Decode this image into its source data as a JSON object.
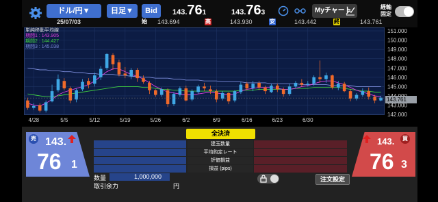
{
  "toolbar": {
    "currency_pair": "ドル/円▼",
    "timeframe": "日足▼",
    "bid_label": "Bid",
    "bid_price": {
      "small": "143.",
      "big": "76",
      "tail": "1"
    },
    "ask_price": {
      "small": "143.",
      "big": "76",
      "tail": "3"
    },
    "my_chart_label": "Myチャート",
    "toggle_label_line1": "経軸",
    "toggle_label_line2": "固定"
  },
  "info": {
    "date": "25/07/03",
    "open_label": "始",
    "open": "143.694",
    "high_label": "高",
    "high": "143.930",
    "low_label": "安",
    "low": "143.442",
    "close_label": "終",
    "close": "143.761"
  },
  "chart_legend": {
    "title": "単純移動平均線",
    "period1": "期間1 : 143.905",
    "period2": "期間2 : 144.427",
    "period3": "期間3 : 145.038"
  },
  "chart_data": {
    "type": "candlestick",
    "x_ticks": [
      "4/28",
      "5/5",
      "5/12",
      "5/19",
      "5/26",
      "6/2",
      "6/9",
      "6/16",
      "6/23",
      "6/30"
    ],
    "y_ticks": [
      "151.000",
      "150.000",
      "149.000",
      "148.000",
      "147.000",
      "146.000",
      "145.000",
      "144.000",
      "143.000",
      "142.000"
    ],
    "ylim": [
      142,
      151.3
    ],
    "current_price": "143.761",
    "candles": [
      [
        143.5,
        142.7,
        143.8,
        142.5
      ],
      [
        142.7,
        142.9,
        143.2,
        142.5
      ],
      [
        143.0,
        142.4,
        143.2,
        142.2
      ],
      [
        142.4,
        143.3,
        143.5,
        142.2
      ],
      [
        143.4,
        144.5,
        145.2,
        143.3
      ],
      [
        144.6,
        145.8,
        146.3,
        144.4
      ],
      [
        145.6,
        144.8,
        145.9,
        144.6
      ],
      [
        144.8,
        143.5,
        145.0,
        143.2
      ],
      [
        143.6,
        144.6,
        144.8,
        143.3
      ],
      [
        144.7,
        145.5,
        145.8,
        144.5
      ],
      [
        145.6,
        145.2,
        145.9,
        144.8
      ],
      [
        145.3,
        146.2,
        146.5,
        145.0
      ],
      [
        146.0,
        146.9,
        147.2,
        145.7
      ],
      [
        147.0,
        148.5,
        148.6,
        146.8
      ],
      [
        148.4,
        147.4,
        148.6,
        146.8
      ],
      [
        147.6,
        146.3,
        147.9,
        146.1
      ],
      [
        146.4,
        146.2,
        147.1,
        145.9
      ],
      [
        146.1,
        146.8,
        147.0,
        145.8
      ],
      [
        146.8,
        145.9,
        147.0,
        145.5
      ],
      [
        145.9,
        145.5,
        146.2,
        145.3
      ],
      [
        145.4,
        144.6,
        145.6,
        144.2
      ],
      [
        144.6,
        144.1,
        144.7,
        143.9
      ],
      [
        144.1,
        144.7,
        144.9,
        143.9
      ],
      [
        144.6,
        143.1,
        144.8,
        142.8
      ],
      [
        143.1,
        144.2,
        144.4,
        142.9
      ],
      [
        144.1,
        144.8,
        145.0,
        143.9
      ],
      [
        144.8,
        143.5,
        145.1,
        143.4
      ],
      [
        143.6,
        144.5,
        144.7,
        143.4
      ],
      [
        144.4,
        145.0,
        145.2,
        144.2
      ],
      [
        145.0,
        144.8,
        145.4,
        144.5
      ],
      [
        144.7,
        144.5,
        145.1,
        144.2
      ],
      [
        144.5,
        143.6,
        144.7,
        143.3
      ],
      [
        143.7,
        144.3,
        144.5,
        143.5
      ],
      [
        144.3,
        143.4,
        144.4,
        143.1
      ],
      [
        143.5,
        144.5,
        144.6,
        143.3
      ],
      [
        144.4,
        145.2,
        145.5,
        144.2
      ],
      [
        145.3,
        144.8,
        145.5,
        144.6
      ],
      [
        144.8,
        145.3,
        145.6,
        144.5
      ],
      [
        145.4,
        144.9,
        145.6,
        144.6
      ],
      [
        144.9,
        144.5,
        145.1,
        144.2
      ],
      [
        144.4,
        145.1,
        145.3,
        144.3
      ],
      [
        145.1,
        144.7,
        145.3,
        144.4
      ],
      [
        144.7,
        144.2,
        144.9,
        143.9
      ],
      [
        144.2,
        145.0,
        145.3,
        144.0
      ],
      [
        145.0,
        145.4,
        145.6,
        144.8
      ],
      [
        145.4,
        145.2,
        145.8,
        145.0
      ],
      [
        145.2,
        145.3,
        145.6,
        145.0
      ],
      [
        145.3,
        146.0,
        146.2,
        145.1
      ],
      [
        146.0,
        145.8,
        147.8,
        145.4
      ],
      [
        145.8,
        146.2,
        146.5,
        145.4
      ],
      [
        146.2,
        144.9,
        146.3,
        144.7
      ],
      [
        144.9,
        145.3,
        145.6,
        144.6
      ],
      [
        145.3,
        144.5,
        145.5,
        144.4
      ],
      [
        144.5,
        143.7,
        144.7,
        143.4
      ],
      [
        143.7,
        144.1,
        144.3,
        143.5
      ],
      [
        144.1,
        144.5,
        144.8,
        143.9
      ],
      [
        144.5,
        143.9,
        144.9,
        143.6
      ],
      [
        143.9,
        143.5,
        144.1,
        143.2
      ],
      [
        143.5,
        143.8,
        144.0,
        143.4
      ]
    ],
    "ma1": [
      143.2,
      143.0,
      142.9,
      143.2,
      143.6,
      144.1,
      144.4,
      144.6,
      144.8,
      145.0,
      145.2,
      145.6,
      146.1,
      146.6,
      146.9,
      146.9,
      146.6,
      146.3,
      146.1,
      145.8,
      145.4,
      145.0,
      144.7,
      144.4,
      144.3,
      144.2,
      144.1,
      144.1,
      144.2,
      144.3,
      144.4,
      144.3,
      144.2,
      144.1,
      144.2,
      144.5,
      144.7,
      144.8,
      144.9,
      144.9,
      144.9,
      144.8,
      144.7,
      144.7,
      144.8,
      145.0,
      145.1,
      145.3,
      145.5,
      145.6,
      145.6,
      145.4,
      145.2,
      144.9,
      144.6,
      144.4,
      144.2,
      144.0,
      143.9
    ],
    "ma2": [
      144.2,
      144.1,
      144.0,
      143.9,
      143.9,
      144.0,
      144.1,
      144.2,
      144.3,
      144.4,
      144.5,
      144.6,
      144.7,
      144.8,
      144.9,
      145.0,
      145.0,
      145.0,
      145.0,
      144.9,
      144.9,
      144.8,
      144.7,
      144.7,
      144.6,
      144.6,
      144.5,
      144.5,
      144.5,
      144.5,
      144.5,
      144.5,
      144.5,
      144.5,
      144.5,
      144.6,
      144.6,
      144.6,
      144.7,
      144.7,
      144.7,
      144.7,
      144.7,
      144.7,
      144.8,
      144.8,
      144.8,
      144.9,
      144.9,
      144.9,
      144.9,
      144.9,
      144.8,
      144.7,
      144.6,
      144.5,
      144.5,
      144.4,
      144.4
    ],
    "ma3": [
      147.0,
      146.9,
      146.8,
      146.8,
      146.7,
      146.7,
      146.6,
      146.6,
      146.5,
      146.5,
      146.4,
      146.4,
      146.3,
      146.3,
      146.3,
      146.2,
      146.2,
      146.1,
      146.1,
      146.0,
      146.0,
      145.9,
      145.9,
      145.9,
      145.8,
      145.8,
      145.7,
      145.7,
      145.7,
      145.6,
      145.6,
      145.6,
      145.5,
      145.5,
      145.5,
      145.5,
      145.4,
      145.4,
      145.4,
      145.4,
      145.3,
      145.3,
      145.3,
      145.3,
      145.3,
      145.2,
      145.2,
      145.2,
      145.2,
      145.2,
      145.1,
      145.1,
      145.1,
      145.1,
      145.0,
      145.0,
      145.0,
      145.0,
      145.0
    ],
    "colors": {
      "up": "#3fa8e6",
      "down": "#f06a2a",
      "ma1": "#e040e0",
      "ma2": "#40d040",
      "ma3": "#7a8ad8"
    }
  },
  "trade": {
    "sell_badge": "売",
    "buy_badge": "買",
    "sell_small": "143.",
    "sell_big": "76",
    "sell_tail": "1",
    "buy_small": "143.",
    "buy_big": "76",
    "buy_tail": "3",
    "close_all": "全決済",
    "rows": [
      "建玉数量",
      "平均約定レート",
      "評価損益",
      "損益 (pips)"
    ],
    "quantity_label": "数量",
    "quantity_value": "1,000,000",
    "margin_label": "取引余力",
    "margin_unit": "円",
    "order_settings": "注文設定"
  }
}
